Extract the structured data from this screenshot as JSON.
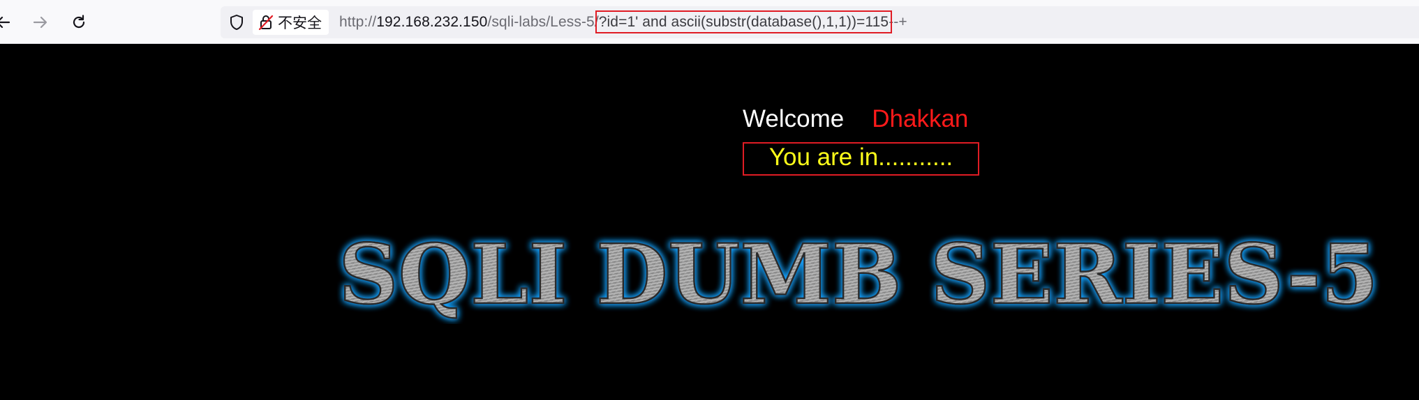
{
  "browser": {
    "back_icon": "arrow-left-icon",
    "forward_icon": "arrow-right-icon",
    "reload_icon": "reload-icon",
    "shield_icon": "shield-icon",
    "insecure_icon": "lock-slash-icon",
    "insecure_label": "不安全",
    "url": {
      "scheme": "http://",
      "host": "192.168.232.150",
      "path": "/sqli-labs/Less-5/",
      "query": "?id=1' and ascii(substr(database(),1,1))=115",
      "suffix": "--+"
    },
    "highlight_color": "#e01c24"
  },
  "page": {
    "welcome": "Welcome",
    "name": "Dhakkan",
    "status": "You are in...........",
    "banner_title": "SQLI DUMB SERIES-5",
    "colors": {
      "background": "#000000",
      "welcome": "#ffffff",
      "name": "#ff1a1a",
      "status": "#ffff1a",
      "banner_glow": "#1aa3ff"
    }
  }
}
